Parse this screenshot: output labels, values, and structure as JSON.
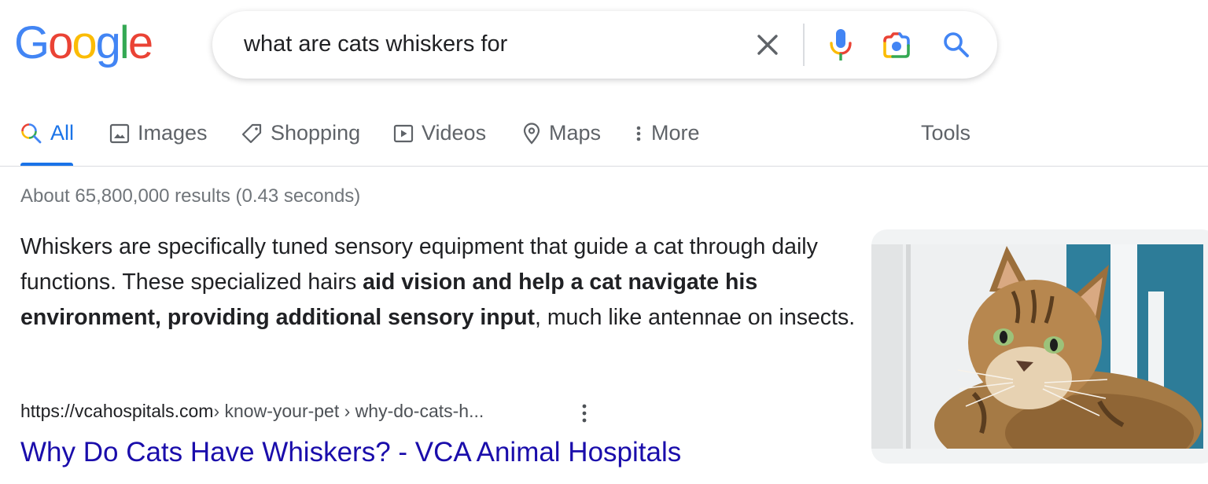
{
  "logo": {
    "text": "Google",
    "letters": [
      {
        "ch": "G",
        "color": "#4285F4"
      },
      {
        "ch": "o",
        "color": "#EA4335"
      },
      {
        "ch": "o",
        "color": "#FBBC05"
      },
      {
        "ch": "g",
        "color": "#4285F4"
      },
      {
        "ch": "l",
        "color": "#34A853"
      },
      {
        "ch": "e",
        "color": "#EA4335"
      }
    ]
  },
  "search": {
    "query": "what are cats whiskers for",
    "icons": [
      "close-icon",
      "microphone-icon",
      "google-lens-icon",
      "search-icon"
    ]
  },
  "tabs": [
    {
      "label": "All",
      "icon": "search-icon",
      "active": true
    },
    {
      "label": "Images",
      "icon": "image-icon"
    },
    {
      "label": "Shopping",
      "icon": "tag-icon"
    },
    {
      "label": "Videos",
      "icon": "play-icon"
    },
    {
      "label": "Maps",
      "icon": "map-pin-icon"
    },
    {
      "label": "More",
      "icon": "more-vert-icon"
    }
  ],
  "tools_label": "Tools",
  "stats": "About 65,800,000 results (0.43 seconds)",
  "featured_snippet": {
    "part1": "Whiskers are specifically tuned sensory equipment that guide a cat through daily functions. These specialized hairs ",
    "bold": "aid vision and help a cat navigate his environment, providing additional sensory input",
    "part2": ", much like antennae on insects."
  },
  "result": {
    "url": "https://vcahospitals.com",
    "breadcrumbs": " › know-your-pet › why-do-cats-h...",
    "title": "Why Do Cats Have Whiskers? - VCA Animal Hospitals"
  },
  "thumbnail": {
    "subject": "tabby-cat-photo"
  },
  "colors": {
    "accent": "#1a73e8",
    "link": "#1a0dab",
    "muted": "#70757a"
  }
}
